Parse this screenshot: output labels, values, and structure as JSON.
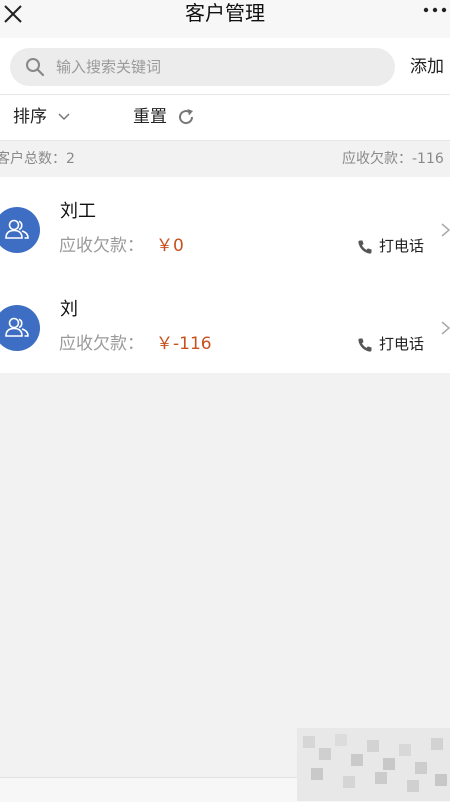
{
  "header": {
    "title": "客户管理"
  },
  "search": {
    "placeholder": "输入搜索关键词",
    "add_label": "添加"
  },
  "filters": {
    "sort_label": "排序",
    "reset_label": "重置"
  },
  "summary": {
    "total_label": "客户总数：",
    "total_value": "2",
    "debt_label": "应收欠款：",
    "debt_value": "-116"
  },
  "customers": [
    {
      "name": "刘工",
      "debt_label": "应收欠款：",
      "debt_value": "￥0",
      "call_label": "打电话"
    },
    {
      "name": "刘",
      "debt_label": "应收欠款：",
      "debt_value": "￥-116",
      "call_label": "打电话"
    }
  ],
  "icons": {
    "close": "close-icon",
    "more": "more-icon",
    "search": "search-icon",
    "sort_toggle": "chevron-down-icon",
    "reset": "refresh-icon",
    "avatar": "user-group-icon",
    "call": "phone-icon",
    "row_open": "chevron-right-icon"
  },
  "colors": {
    "accent": "#3d6ec4",
    "debt": "#c9511e",
    "muted_text": "#9a9a9a"
  }
}
